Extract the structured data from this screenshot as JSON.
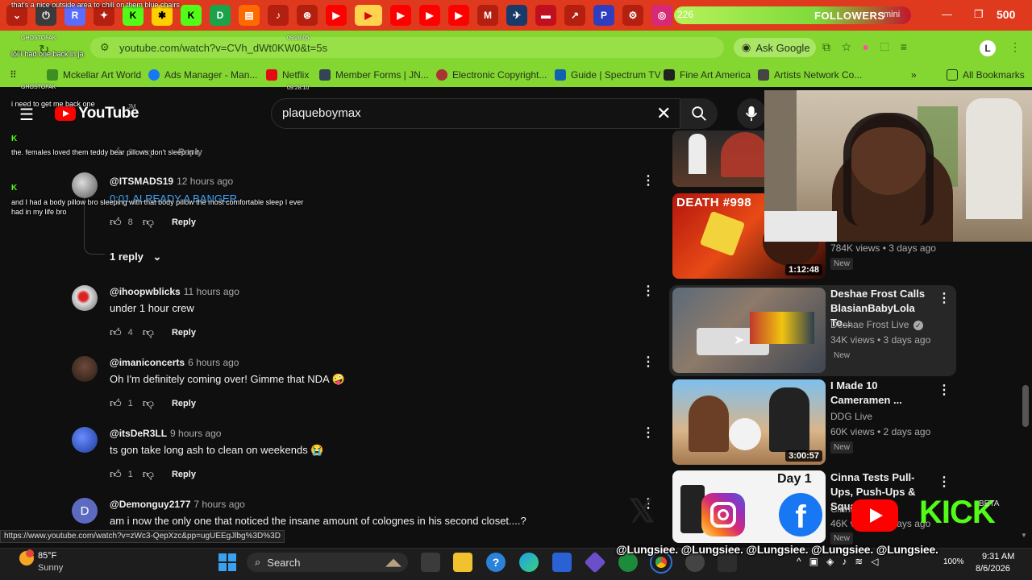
{
  "browser": {
    "tab_count": "500",
    "followers": {
      "count": "226",
      "label": "FOLLOWERS",
      "sub": "mini"
    },
    "url": "youtube.com/watch?v=CVh_dWt0KW0&t=5s",
    "ask_google": "Ask Google",
    "profile_initial": "L",
    "bookmarks": [
      "Mckellar Art World",
      "Ads Manager - Man...",
      "Netflix",
      "Member Forms | JN...",
      "Electronic Copyright...",
      "Guide | Spectrum TV",
      "Fine Art America",
      "Artists Network Co...",
      "All Bookmarks"
    ],
    "tab_labels": [
      "R",
      "K",
      "D",
      "M"
    ]
  },
  "chat": [
    {
      "user": "",
      "time": "",
      "text": "that's a nice outside area to chill on them blue chairs"
    },
    {
      "user": "GHOSTOFAK",
      "time": "09:28:05",
      "text": "lol I had one back in ja"
    },
    {
      "user": "GHOSTOFAK",
      "time": "09:28:10",
      "text": "i need to get me back one"
    },
    {
      "user": "",
      "time": "",
      "text": "the. females loved them teddy bear pillows don't sleep in it"
    },
    {
      "user": "",
      "time": "",
      "text": "and I had a body pillow bro sleeping with that body pillow the most comfortable sleep I ever"
    },
    {
      "user": "",
      "time": "",
      "text": "had in my life bro"
    }
  ],
  "youtube": {
    "logo": "YouTube",
    "region": "JM",
    "search_query": "plaqueboymax",
    "comments": [
      {
        "author": "@ITSMADS19",
        "time": "12 hours ago",
        "text": "0:01 ALREADY A BANGER",
        "likes": "8",
        "reply": "Reply"
      },
      {
        "author": "@ihoopwblicks",
        "time": "11 hours ago",
        "text": "under 1 hour crew",
        "likes": "4",
        "reply": "Reply"
      },
      {
        "author": "@imaniconcerts",
        "time": "6 hours ago",
        "text": "Oh I'm definitely coming over! Gimme that NDA 🤪",
        "likes": "1",
        "reply": "Reply"
      },
      {
        "author": "@itsDeR3LL",
        "time": "9 hours ago",
        "text": "ts gon take long ash to clean on weekends 😭",
        "likes": "1",
        "reply": "Reply"
      },
      {
        "author": "@Demonguy2177",
        "time": "7 hours ago",
        "text": "am i now the only one that noticed the insane amount of colognes in his second closet....?",
        "likes": "",
        "reply": "Reply"
      }
    ],
    "top_reply_likes": "1",
    "top_reply_label": "Reply",
    "replies_toggle": "1 reply",
    "avatar_initial_d": "D",
    "recommendations": [
      {
        "thumb_text": "DEATH #998",
        "duration": "1:12:48",
        "title": "",
        "channel": "",
        "meta": "784K views • 3 days ago",
        "badge": "New"
      },
      {
        "thumb_text": "",
        "duration": "",
        "title": "Deshae Frost Calls BlasianBabyLola To...",
        "channel": "Deshae Frost Live",
        "meta": "34K views • 3 days ago",
        "badge": "New"
      },
      {
        "thumb_text": "",
        "duration": "3:00:57",
        "title": "I Made 10 Cameramen ...",
        "channel": "DDG Live",
        "meta": "60K views • 2 days ago",
        "badge": "New"
      },
      {
        "thumb_text": "Day 1",
        "duration": "",
        "title": "Cinna Tests Pull-Ups, Push-Ups & Squat ...",
        "channel": "Cinna",
        "meta": "46K views • 4 days ago",
        "badge": "New"
      }
    ]
  },
  "status_url": "https://www.youtube.com/watch?v=zWc3-QepXzc&pp=ugUEEgJlbg%3D%3D",
  "social": {
    "handles": "@Lungsiee. @Lungsiee. @Lungsiee. @Lungsiee. @Lungsiee.",
    "kick_label": "KICK",
    "beta": "BETA"
  },
  "taskbar": {
    "weather_temp": "85°F",
    "weather_cond": "Sunny",
    "search": "Search",
    "battery": "100%",
    "time": "9:31 AM",
    "date": "8/6/2026"
  },
  "colors": {
    "tabbar": "#e03a1e",
    "address_bar": "#84d631",
    "youtube_red": "#ff0000",
    "kick_green": "#53fc18"
  }
}
